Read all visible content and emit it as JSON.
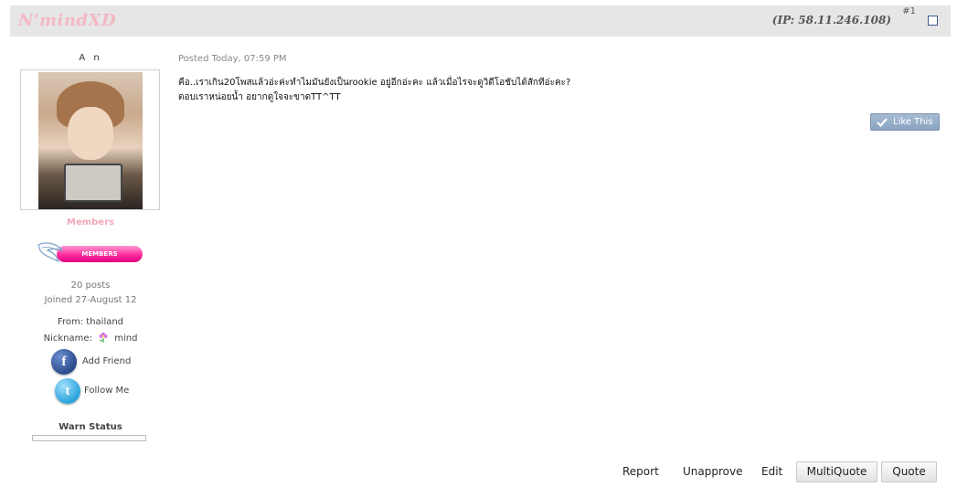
{
  "header": {
    "username": "N'mindXD",
    "ip": "(IP: 58.11.246.108)",
    "post_number": "#1"
  },
  "author": {
    "name": "A n",
    "group": "Members",
    "badge_text": "MEMBERS",
    "posts": "20 posts",
    "joined": "Joined 27-August 12",
    "from": "From: thailand",
    "nickname_label": "Nickname:",
    "nickname_value": "mind",
    "add_friend": "Add Friend",
    "follow_me": "Follow Me",
    "warn_status": "Warn Status"
  },
  "post": {
    "date": "Posted Today, 07:59 PM",
    "line1": "คือ..เราเกิน20โพสแล้วอ่ะค่ะทำไมมันยังเป็นrookie อยู่อีกอ่ะคะ แล้วเมื่อไรจะดูวิดีโอชับได้สักทีอ่ะคะ?",
    "line2": "ตอบเราหน่อยน้ำ อยากดูใจจะขาดTT^TT"
  },
  "like_button": "Like This",
  "actions": {
    "report": "Report",
    "unapprove": "Unapprove",
    "edit": "Edit",
    "multiquote": "MultiQuote",
    "quote": "Quote"
  },
  "icons": {
    "facebook": "facebook-icon",
    "twitter": "twitter-icon",
    "flower": "flower-icon",
    "check": "check-icon",
    "wing": "wing-icon"
  },
  "colors": {
    "username": "#f4b8c4",
    "group": "#f4a7b9",
    "badge": "#ff2e9e",
    "like": "#8aa4c2"
  }
}
